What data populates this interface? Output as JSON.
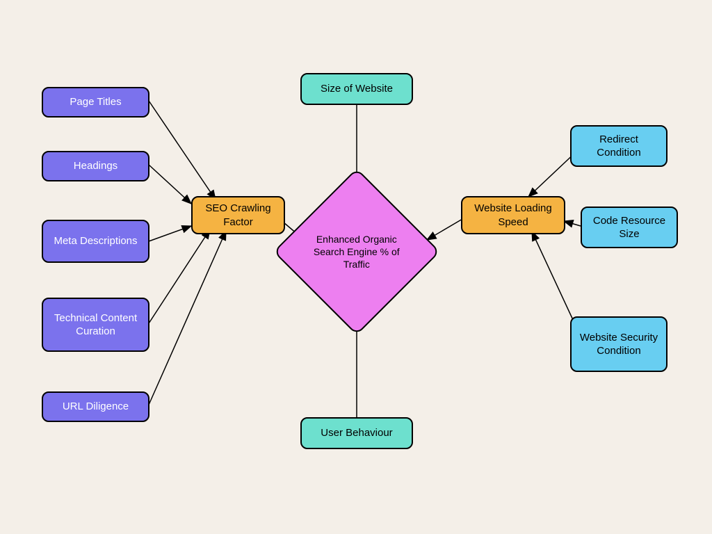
{
  "center": {
    "label": "Enhanced Organic Search Engine % of Traffic"
  },
  "intermediate": {
    "seo": "SEO Crawling Factor",
    "loading": "Website Loading Speed"
  },
  "top": {
    "size": "Size of Website"
  },
  "bottom": {
    "behaviour": "User Behaviour"
  },
  "left_factors": {
    "titles": "Page Titles",
    "headings": "Headings",
    "meta": "Meta Descriptions",
    "technical": "Technical Content Curation",
    "url": "URL Diligence"
  },
  "right_factors": {
    "redirect": "Redirect Condition",
    "code": "Code Resource Size",
    "security": "Website Security Condition"
  }
}
